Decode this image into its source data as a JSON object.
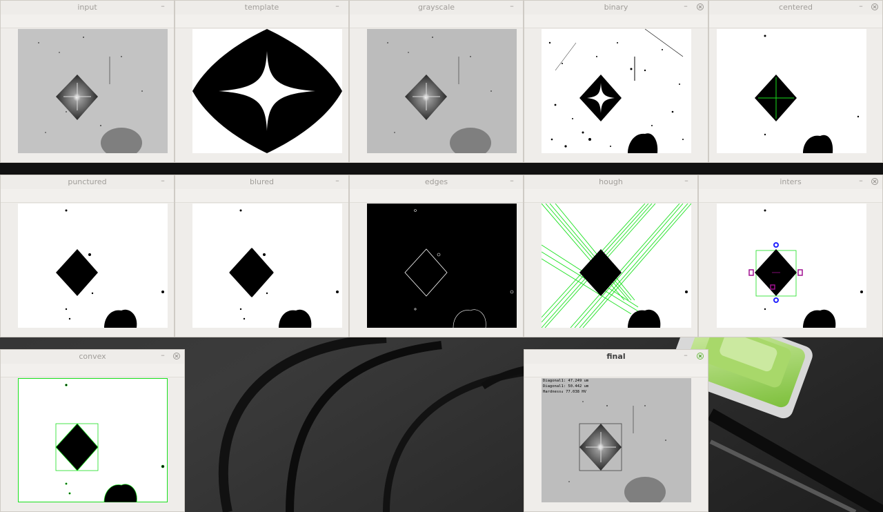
{
  "windows": {
    "input": {
      "title": "input"
    },
    "template": {
      "title": "template"
    },
    "grayscale": {
      "title": "grayscale"
    },
    "binary": {
      "title": "binary"
    },
    "centered": {
      "title": "centered"
    },
    "punctured": {
      "title": "punctured"
    },
    "blured": {
      "title": "blured"
    },
    "edges": {
      "title": "edges"
    },
    "hough": {
      "title": "hough"
    },
    "inters": {
      "title": "inters"
    },
    "convex": {
      "title": "convex"
    },
    "final": {
      "title": "final",
      "overlay": {
        "line1": "Diagonal1: 47.249 um",
        "line2": "Diagonal1: 50.442 um",
        "line3": "Hardness: 77.038 HV"
      }
    }
  },
  "colors": {
    "overlay_green": "#18e01c",
    "overlay_blue": "#2020ff",
    "overlay_magenta": "#a01090",
    "close_active": "#6fb645"
  }
}
